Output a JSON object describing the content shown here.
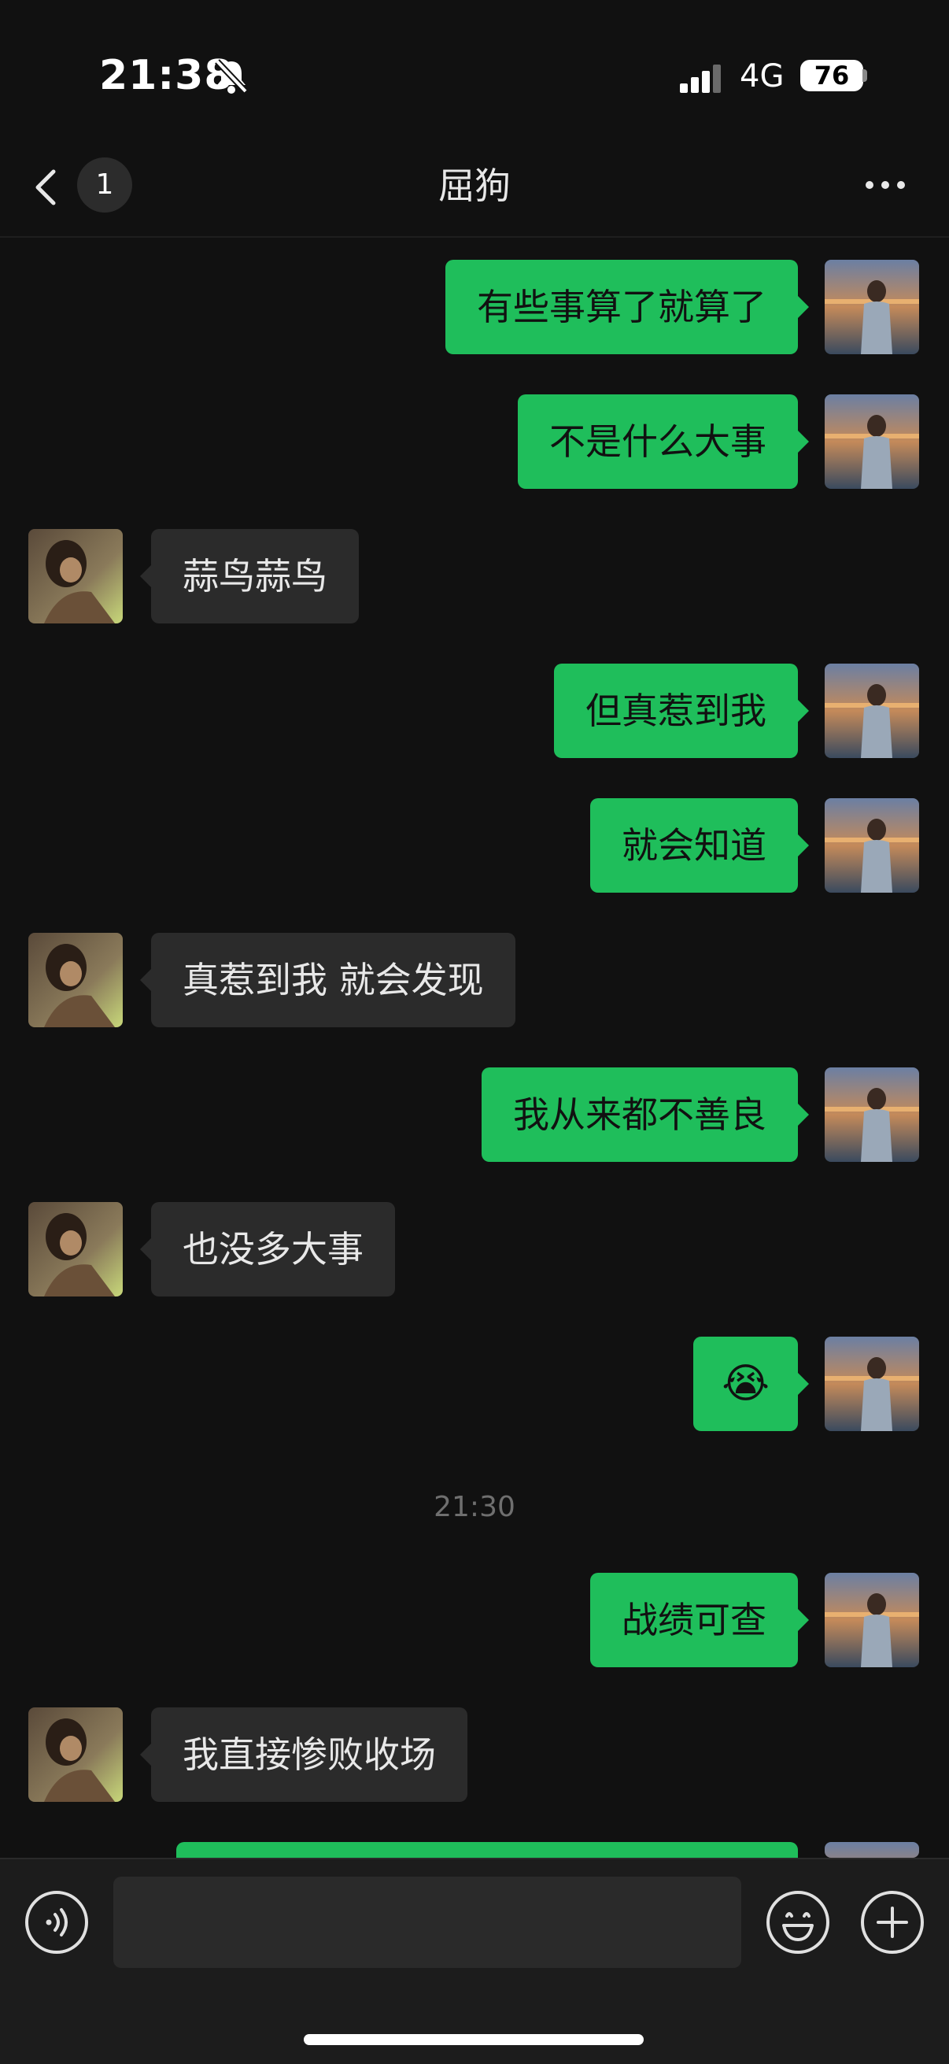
{
  "status_bar": {
    "time": "21:38",
    "network": "4G",
    "battery": "76"
  },
  "nav": {
    "unread_count": "1",
    "title": "屈狗"
  },
  "messages": [
    {
      "from": "me",
      "text": "有些事算了就算了"
    },
    {
      "from": "me",
      "text": "不是什么大事"
    },
    {
      "from": "other",
      "text": "蒜鸟蒜鸟"
    },
    {
      "from": "me",
      "text": "但真惹到我"
    },
    {
      "from": "me",
      "text": "就会知道"
    },
    {
      "from": "other",
      "text": "真惹到我 就会发现"
    },
    {
      "from": "me",
      "text": "我从来都不善良"
    },
    {
      "from": "other",
      "text": "也没多大事"
    },
    {
      "from": "me",
      "text": "😭",
      "type": "emoji"
    },
    {
      "from": "me",
      "text": "战绩可查"
    },
    {
      "from": "other",
      "text": "我直接惨败收场"
    }
  ],
  "timestamp": "21:30",
  "input": {
    "placeholder": ""
  },
  "colors": {
    "sent_bubble": "#1fbe5b",
    "received_bubble": "#2b2b2b",
    "background": "#111111"
  },
  "icons": [
    "mute-bell-icon",
    "signal-icon",
    "battery-icon",
    "back-chevron-icon",
    "more-dots-icon",
    "voice-icon",
    "emoji-icon",
    "plus-icon"
  ]
}
